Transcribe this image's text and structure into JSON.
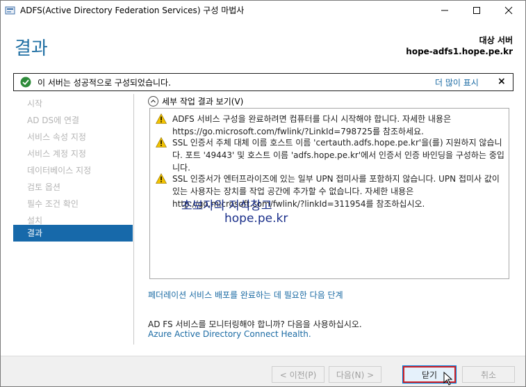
{
  "window": {
    "title": "ADFS(Active Directory Federation Services) 구성 마법사"
  },
  "header": {
    "page_title": "결과",
    "destination_label": "대상 서버",
    "destination_value": "hope-adfs1.hope.pe.kr"
  },
  "notice": {
    "text": "이 서버는 성공적으로 구성되었습니다.",
    "more_link": "더 많이 표시",
    "close": "×"
  },
  "sidebar": {
    "items": [
      {
        "label": "시작",
        "active": false
      },
      {
        "label": "AD DS에 연결",
        "active": false
      },
      {
        "label": "서비스 속성 지정",
        "active": false
      },
      {
        "label": "서비스 계정 지정",
        "active": false
      },
      {
        "label": "데이터베이스 지정",
        "active": false
      },
      {
        "label": "검토 옵션",
        "active": false
      },
      {
        "label": "필수 조건 확인",
        "active": false
      },
      {
        "label": "설치",
        "active": false
      },
      {
        "label": "결과",
        "active": true
      }
    ]
  },
  "details": {
    "toggle_label": "세부 작업 결과 보기(V)",
    "warnings": [
      {
        "icon": "warning-icon",
        "text": "ADFS 서비스 구성을 완료하려면 컴퓨터를 다시 시작해야 합니다. 자세한 내용은 https://go.microsoft.com/fwlink/?LinkId=798725를 참조하세요."
      },
      {
        "icon": "warning-icon",
        "text": "SSL 인증서 주체 대체 이름 호스트 이름 'certauth.adfs.hope.pe.kr'을(를) 지원하지 않습니다. 포트 '49443' 및 호스트 이름 'adfs.hope.pe.kr'에서 인증서 인증 바인딩을 구성하는 중입니다."
      },
      {
        "icon": "warning-icon",
        "text": "SSL 인증서가 엔터프라이즈에 있는 일부 UPN 접미사를 포함하지 않습니다. UPN 접미사 값이 있는 사용자는 장치를 작업 공간에 추가할 수 없습니다. 자세한 내용은 http://go.microsoft.com/fwlink/?linkId=311954를 참조하십시오."
      }
    ]
  },
  "watermark": {
    "line1": "초보자의 지식창고",
    "line2": "hope.pe.kr"
  },
  "links": {
    "next_steps": "페더레이션 서비스 배포를 완료하는 데 필요한 다음 단계",
    "monitor_text": "AD FS 서비스를 모니터링해야 합니까? 다음을 사용하십시오.",
    "monitor_link": "Azure Active Directory Connect Health."
  },
  "footer": {
    "prev": "< 이전(P)",
    "next": "다음(N) >",
    "close": "닫기",
    "cancel": "취소"
  },
  "colors": {
    "accent": "#1769aa",
    "title_blue": "#1f6fa3",
    "link": "#1a6aa3",
    "highlight_red": "#d32124",
    "success_green": "#2e8b3a",
    "warning_yellow": "#f2c200"
  }
}
